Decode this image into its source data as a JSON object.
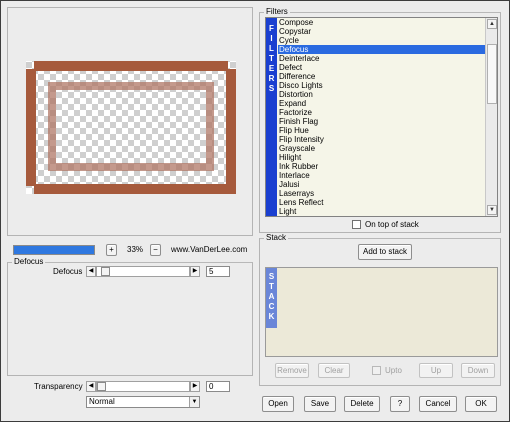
{
  "filters": {
    "title": "Filters",
    "band_letters": [
      "F",
      "I",
      "L",
      "T",
      "E",
      "R",
      "S"
    ],
    "items": [
      "Compose",
      "Copystar",
      "Cycle",
      "Defocus",
      "Deinterlace",
      "Defect",
      "Difference",
      "Disco Lights",
      "Distortion",
      "Expand",
      "Factorize",
      "Finish Flag",
      "Flip Hue",
      "Flip Intensity",
      "Grayscale",
      "Hilight",
      "Ink Rubber",
      "Interlace",
      "Jalusi",
      "Laserrays",
      "Lens Reflect",
      "Light"
    ],
    "selected": "Defocus",
    "on_top_label": "On top of stack",
    "on_top_checked": false
  },
  "stack": {
    "title": "Stack",
    "add_button": "Add to stack",
    "band_letters": [
      "S",
      "T",
      "A",
      "C",
      "K"
    ],
    "remove": "Remove",
    "clear": "Clear",
    "upto": "Upto",
    "up": "Up",
    "down": "Down"
  },
  "preview": {
    "zoom_plus": "+",
    "zoom_minus": "−",
    "zoom_value": "33%",
    "website": "www.VanDerLee.com",
    "progress": 1.0
  },
  "defocus": {
    "group_title": "Defocus",
    "param_label": "Defocus",
    "param_value": "5",
    "slider_fraction": 0.05
  },
  "transparency": {
    "label": "Transparency",
    "value": "0",
    "slider_fraction": 0.0,
    "blend_mode": "Normal"
  },
  "footer": {
    "open": "Open",
    "save": "Save",
    "delete": "Delete",
    "help": "?",
    "cancel": "Cancel",
    "ok": "OK"
  },
  "colors": {
    "filter_band": "#1a3fd0",
    "selection": "#2a6ae0",
    "frame_brown": "#a65a3c"
  }
}
